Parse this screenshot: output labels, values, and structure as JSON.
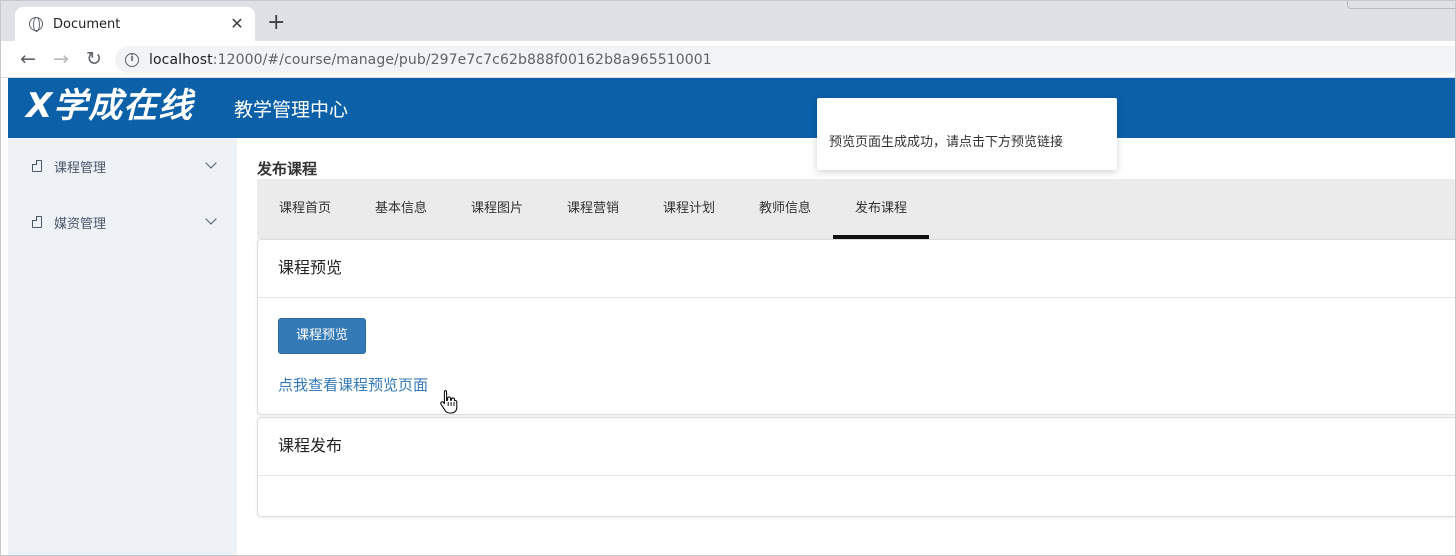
{
  "browser": {
    "tab_title": "Document",
    "close_glyph": "✕",
    "new_tab_glyph": "+",
    "back_glyph": "←",
    "forward_glyph": "→",
    "reload_glyph": "↻",
    "url_host": "localhost",
    "url_rest": ":12000/#/course/manage/pub/297e7c7c62b888f00162b8a965510001"
  },
  "header": {
    "logo_text": "X学成在线",
    "subtitle": "教学管理中心",
    "bg_color": "#0b60a8"
  },
  "sidebar": {
    "items": [
      {
        "label": "课程管理",
        "icon": "document-icon"
      },
      {
        "label": "媒资管理",
        "icon": "document-icon"
      }
    ]
  },
  "main": {
    "page_title": "发布课程",
    "tabs": [
      {
        "label": "课程首页"
      },
      {
        "label": "基本信息"
      },
      {
        "label": "课程图片"
      },
      {
        "label": "课程营销"
      },
      {
        "label": "课程计划"
      },
      {
        "label": "教师信息"
      },
      {
        "label": "发布课程",
        "active": true
      }
    ],
    "preview_panel": {
      "title": "课程预览",
      "button_label": "课程预览",
      "link_text": "点我查看课程预览页面"
    },
    "publish_panel": {
      "title": "课程发布"
    }
  },
  "toast": {
    "message": "预览页面生成成功，请点击下方预览链接"
  },
  "colors": {
    "primary_button": "#337ab7",
    "link": "#337ab7",
    "sidebar_bg": "#eef1f6",
    "tabs_bg": "#ebebeb"
  }
}
